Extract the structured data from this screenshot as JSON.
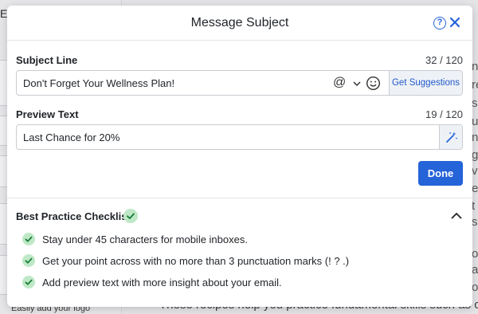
{
  "background": {
    "left_title_fragment": "Ele",
    "logo_note": "Easily add your logo",
    "edge_fragments": [
      "n",
      "re",
      "s",
      "ut",
      "ns",
      "g",
      "vi",
      "e",
      "t",
      "s",
      "o",
      "a",
      "o",
      "e",
      "sl"
    ],
    "bottom_text": "These recipes help you practice fundamental skills such as ch"
  },
  "modal": {
    "title": "Message Subject",
    "help_icon": "question-circle-icon",
    "close_icon": "close-icon"
  },
  "subject": {
    "label": "Subject Line",
    "counter": "32 / 120",
    "value": "Don't Forget Your Wellness Plan!",
    "at_icon": "@",
    "suggest_label": "Get Suggestions"
  },
  "preview": {
    "label": "Preview Text",
    "counter": "19 / 120",
    "value": "Last Chance for 20%"
  },
  "done_label": "Done",
  "checklist": {
    "title": "Best Practice Checklist",
    "items": [
      "Stay under 45 characters for mobile inboxes.",
      "Get your point across with no more than 3 punctuation marks (! ? .)",
      "Add preview text with more insight about your email."
    ]
  },
  "colors": {
    "accent": "#2563d8",
    "check_bg": "#bfe8c7",
    "check_fg": "#1c7f3a"
  }
}
